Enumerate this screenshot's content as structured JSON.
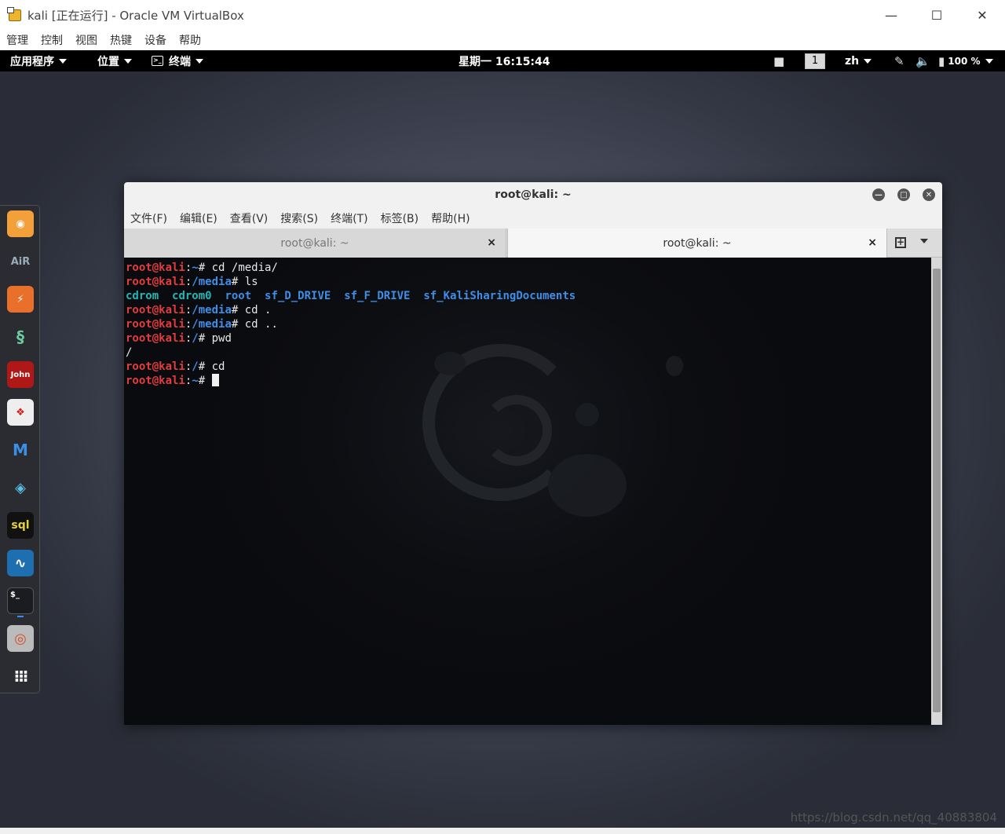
{
  "vbox": {
    "title": "kali [正在运行] - Oracle VM VirtualBox",
    "menu": [
      "管理",
      "控制",
      "视图",
      "热键",
      "设备",
      "帮助"
    ],
    "min": "—",
    "max": "☐",
    "close": "✕"
  },
  "topbar": {
    "apps": "应用程序",
    "places": "位置",
    "terminal": "终端",
    "clock": "星期一 16:15:44",
    "workspace": "1",
    "lang": "zh",
    "battery": "100 %"
  },
  "terminal": {
    "title": "root@kali: ~",
    "menu": [
      "文件(F)",
      "编辑(E)",
      "查看(V)",
      "搜索(S)",
      "终端(T)",
      "标签(B)",
      "帮助(H)"
    ],
    "tabs": [
      {
        "label": "root@kali: ~"
      },
      {
        "label": "root@kali: ~"
      }
    ],
    "tab_close": "×",
    "lines": [
      {
        "user": "root@kali",
        "path": "~",
        "cmd": " cd /media/"
      },
      {
        "user": "root@kali",
        "path": "/media",
        "cmd": " ls"
      },
      {
        "ls": [
          "cdrom",
          "cdrom0",
          "root",
          "sf_D_DRIVE",
          "sf_F_DRIVE",
          "sf_KaliSharingDocuments"
        ]
      },
      {
        "user": "root@kali",
        "path": "/media",
        "cmd": " cd ."
      },
      {
        "user": "root@kali",
        "path": "/media",
        "cmd": " cd .."
      },
      {
        "user": "root@kali",
        "path": "/",
        "cmd": " pwd"
      },
      {
        "out": "/"
      },
      {
        "user": "root@kali",
        "path": "/",
        "cmd": " cd"
      },
      {
        "user": "root@kali",
        "path": "~",
        "cmd": " ",
        "cursor": true
      }
    ]
  },
  "dock": [
    "firefox-icon",
    "aircrack-icon",
    "burpsuite-icon",
    "maltego-icon",
    "john-icon",
    "armitage-icon",
    "metasploit-icon",
    "faraday-icon",
    "sqlmap-icon",
    "wireshark-icon",
    "terminal-icon",
    "chromium-icon",
    "show-apps-icon"
  ],
  "watermark": "https://blog.csdn.net/qq_40883804"
}
